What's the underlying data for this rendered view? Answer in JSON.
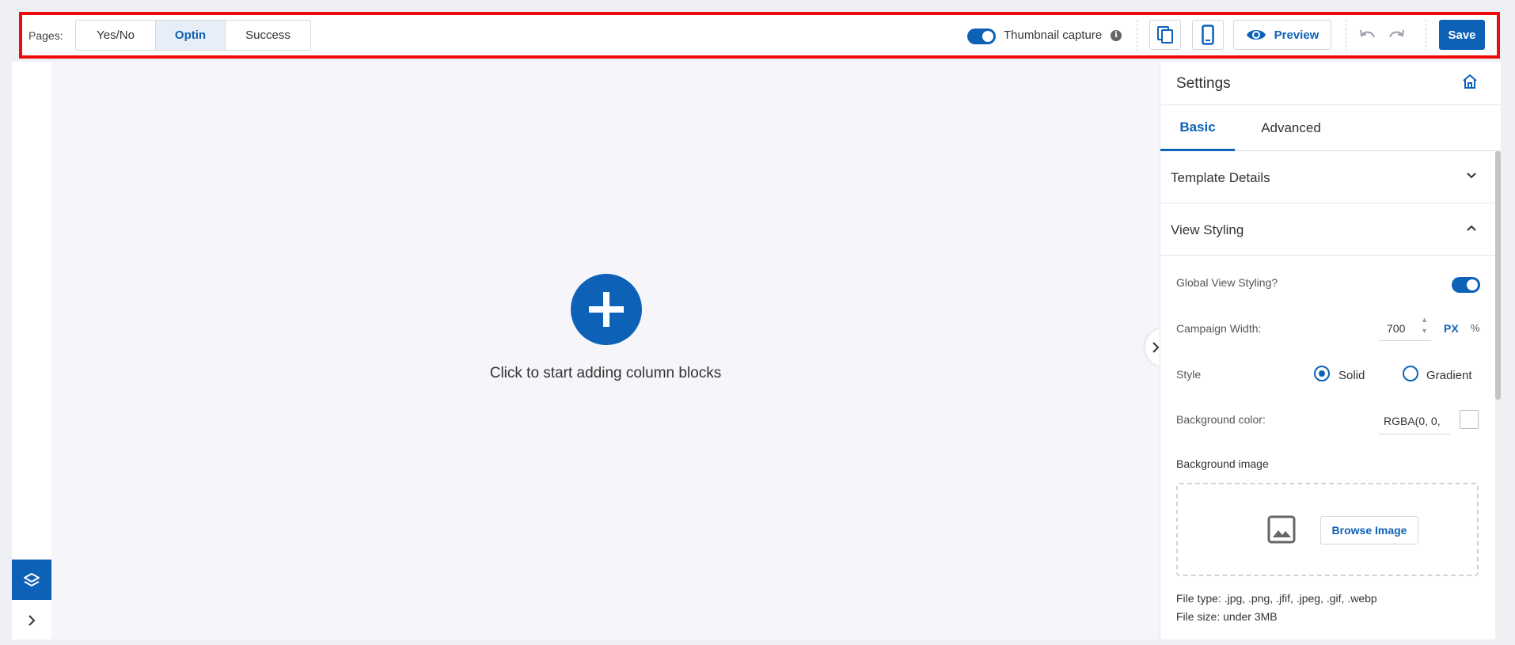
{
  "toolbar": {
    "pages_label": "Pages:",
    "pages": [
      {
        "label": "Yes/No"
      },
      {
        "label": "Optin",
        "active": true
      },
      {
        "label": "Success"
      }
    ],
    "thumbnail_capture_label": "Thumbnail capture",
    "thumbnail_capture_on": true,
    "info_glyph": "i",
    "preview_label": "Preview",
    "save_label": "Save",
    "icons": [
      "copy-icon",
      "mobile-icon",
      "eye-icon",
      "undo-icon",
      "redo-icon"
    ]
  },
  "canvas": {
    "add_blocks_text": "Click to start adding column blocks"
  },
  "settings": {
    "title": "Settings",
    "tabs": [
      {
        "label": "Basic",
        "active": true
      },
      {
        "label": "Advanced"
      }
    ],
    "sections": {
      "template_details": "Template Details",
      "view_styling": "View Styling"
    },
    "global_view_styling": {
      "label": "Global View Styling?",
      "on": true
    },
    "campaign_width": {
      "label": "Campaign Width:",
      "value": "700",
      "unit_px": "PX",
      "unit_pct": "%"
    },
    "style": {
      "label": "Style",
      "options": [
        "Solid",
        "Gradient"
      ],
      "selected": "Solid"
    },
    "background_color": {
      "label": "Background color:",
      "value": "RGBA(0, 0,"
    },
    "background_image": {
      "label": "Background image",
      "browse_label": "Browse Image"
    },
    "file_type": "File type: .jpg, .png, .jfif, .jpeg, .gif, .webp",
    "file_size": "File size: under 3MB"
  },
  "colors": {
    "accent": "#0d62b8",
    "highlight_border": "#f00a0a"
  }
}
